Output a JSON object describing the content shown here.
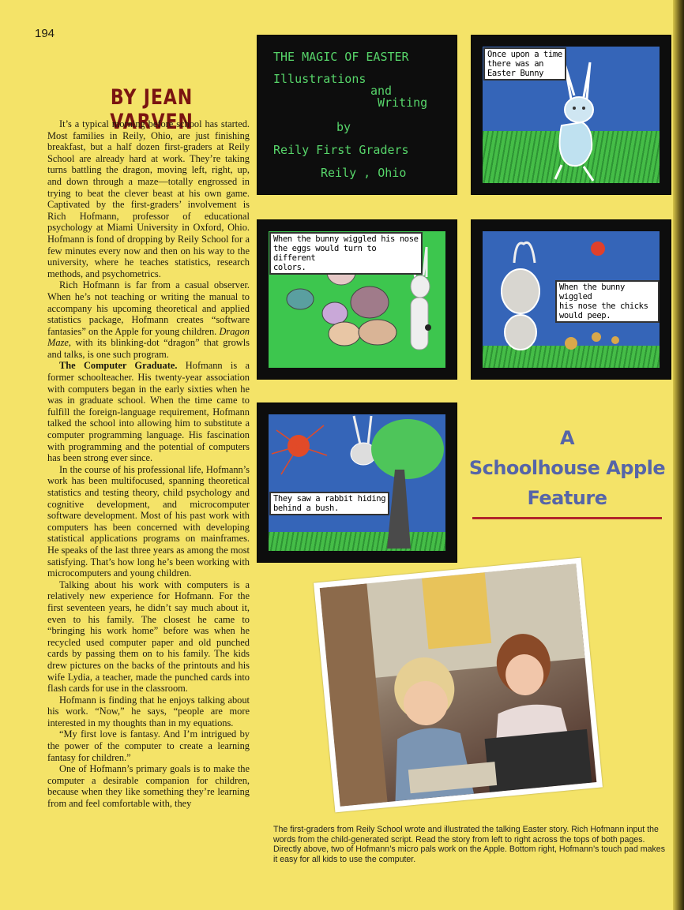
{
  "page_number": "194",
  "byline": "BY JEAN VARVEN",
  "article": {
    "p1": "It’s a typical morning before school has started. Most families in Reily, Ohio, are just finishing breakfast, but a half dozen first-graders at Reily School are already hard at work. They’re taking turns battling the dragon, moving left, right, up, and down through a maze—totally engrossed in trying to beat the clever beast at his own game. Captivated by the first-graders’ involvement is Rich Hofmann, professor of educational psychology at Miami University in Oxford, Ohio. Hofmann is fond of dropping by Reily School for a few minutes every now and then on his way to the university, where he teaches statistics, research methods, and psychometrics.",
    "p2_before": "Rich Hofmann is far from a casual observer. When he’s not teaching or writing the manual to accompany his upcoming theoretical and applied statistics package, Hofmann creates “software fantasies” on the Apple for young children. ",
    "p2_title": "Dragon Maze",
    "p2_after": ", with its blinking-dot “dragon” that growls and talks, is one such program.",
    "p3_lead": "The Computer Graduate.",
    "p3": " Hofmann is a former schoolteacher. His twenty-year association with computers began in the early sixties when he was in graduate school. When the time came to fulfill the foreign-language requirement, Hofmann talked the school into allowing him to substitute a computer programming language. His fascination with programming and the potential of computers has been strong ever since.",
    "p4": "In the course of his professional life, Hofmann’s work has been multifocused, spanning theoretical statistics and testing theory, child psychology and cognitive development, and microcomputer software development. Most of his past work with computers has been concerned with developing statistical applications programs on mainframes. He speaks of the last three years as among the most satisfying. That’s how long he’s been working with microcomputers and young children.",
    "p5": "Talking about his work with computers is a relatively new experience for Hofmann. For the first seventeen years, he didn’t say much about it, even to his family. The closest he came to “bringing his work home” before was when he recycled used computer paper and old punched cards by passing them on to his family. The kids drew pictures on the backs of the printouts and his wife Lydia, a teacher, made the punched cards into flash cards for use in the classroom.",
    "p6": "Hofmann is finding that he enjoys talking about his work. “Now,” he says, “people are more interested in my thoughts than in my equations.",
    "p7": "“My first love is fantasy. And I’m intrigued by the power of the computer to create a learning fantasy for children.”",
    "p8": "One of Hofmann’s primary goals is to make the computer a desirable companion for children, because when they like something they’re learning from and feel comfortable with, they"
  },
  "screens": {
    "title": {
      "line1": "THE MAGIC OF EASTER",
      "line2": "Illustrations",
      "line3": "and",
      "line4": "Writing",
      "line5": "by",
      "line6": "Reily First Graders",
      "line7": "Reily , Ohio"
    },
    "s2_text": "Once upon a time\nthere was an\nEaster Bunny",
    "s3_text": "When the bunny wiggled his nose\nthe eggs would turn to\ndifferent\ncolors.",
    "s4_text": "When the bunny wiggled\nhis nose the chicks\nwould peep.",
    "s5_text": "They saw a rabbit hiding\nbehind a bush."
  },
  "feature": {
    "line1": "A",
    "line2": "Schoolhouse Apple",
    "line3": "Feature"
  },
  "photo_caption": "The first-graders from Reily School wrote and illustrated the talking Easter story. Rich Hofmann input the words from the child-generated script. Read the story from left to right across the tops of both pages. Directly above, two of Hofmann’s micro pals work on the Apple. Bottom right, Hofmann’s touch pad makes it easy for all kids to use the computer.",
  "colors": {
    "page": "#f4e368",
    "byline": "#7a1411",
    "feature": "#5665a8",
    "rule": "#b2262b",
    "screen_text": "#57d56a"
  }
}
